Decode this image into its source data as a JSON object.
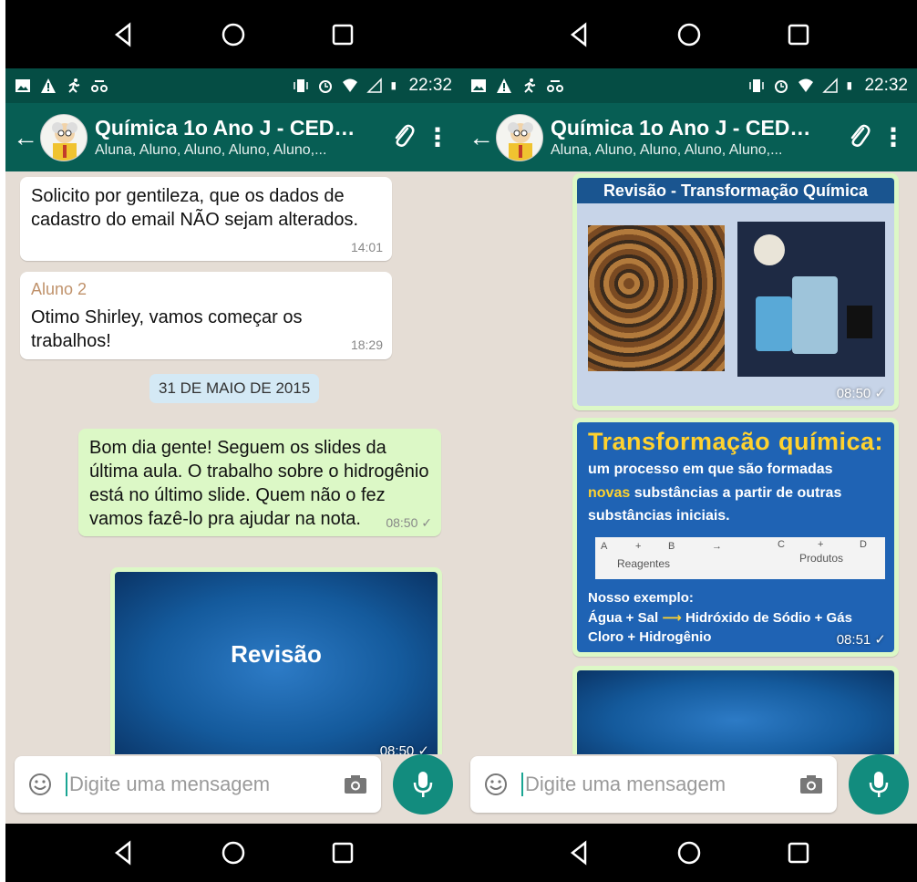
{
  "android_nav": {
    "back_icon": "back-triangle-icon",
    "home_icon": "home-circle-icon",
    "recents_icon": "recents-square-icon"
  },
  "status_bar": {
    "time": "22:32"
  },
  "chat_header": {
    "title": "Química 1o Ano J - CEDEP...",
    "left_subtitle": "Aluna, Aluno, Aluno, Aluno, Aluno,...",
    "right_subtitle": "Aluna, Aluno, Aluno, Aluno, Aluno,..."
  },
  "left_messages": {
    "msg1": {
      "text": "Solicito por gentileza, que os dados de cadastro do email NÃO sejam alterados.",
      "time": "14:01"
    },
    "msg2": {
      "sender": "Aluno 2",
      "text": "Otimo Shirley, vamos começar os trabalhos!",
      "time": "18:29"
    },
    "date": "31 DE MAIO DE 2015",
    "msg3": {
      "text": "Bom dia gente! Seguem os slides da última aula. O trabalho sobre o hidrogênio está no último slide. Quem não o fez vamos fazê-lo pra ajudar na nota.",
      "time": "08:50 ✓"
    },
    "img1": {
      "slide_title": "Revisão",
      "time": "08:50 ✓"
    }
  },
  "right_messages": {
    "img1": {
      "header": "Revisão - Transformação Química",
      "time": "08:50 ✓"
    },
    "img2": {
      "title_left": "Transformação",
      "title_right": "química:",
      "line1": "um processo em que são formadas",
      "highlight": "novas",
      "line2_rest": "substâncias a partir de outras",
      "line3": "substâncias iniciais.",
      "eq_a": "A",
      "eq_plus1": "+",
      "eq_b": "B",
      "eq_arrow": "→",
      "eq_c": "C",
      "eq_plus2": "+",
      "eq_d": "D",
      "eq_reagentes": "Reagentes",
      "eq_produtos": "Produtos",
      "example_label": "Nosso exemplo:",
      "example_left": "Água + Sal",
      "example_right": "Hidróxido de Sódio + Gás",
      "example_line2": "Cloro + Hidrogênio",
      "time": "08:51 ✓"
    }
  },
  "composer": {
    "placeholder": "Digite uma mensagem"
  }
}
